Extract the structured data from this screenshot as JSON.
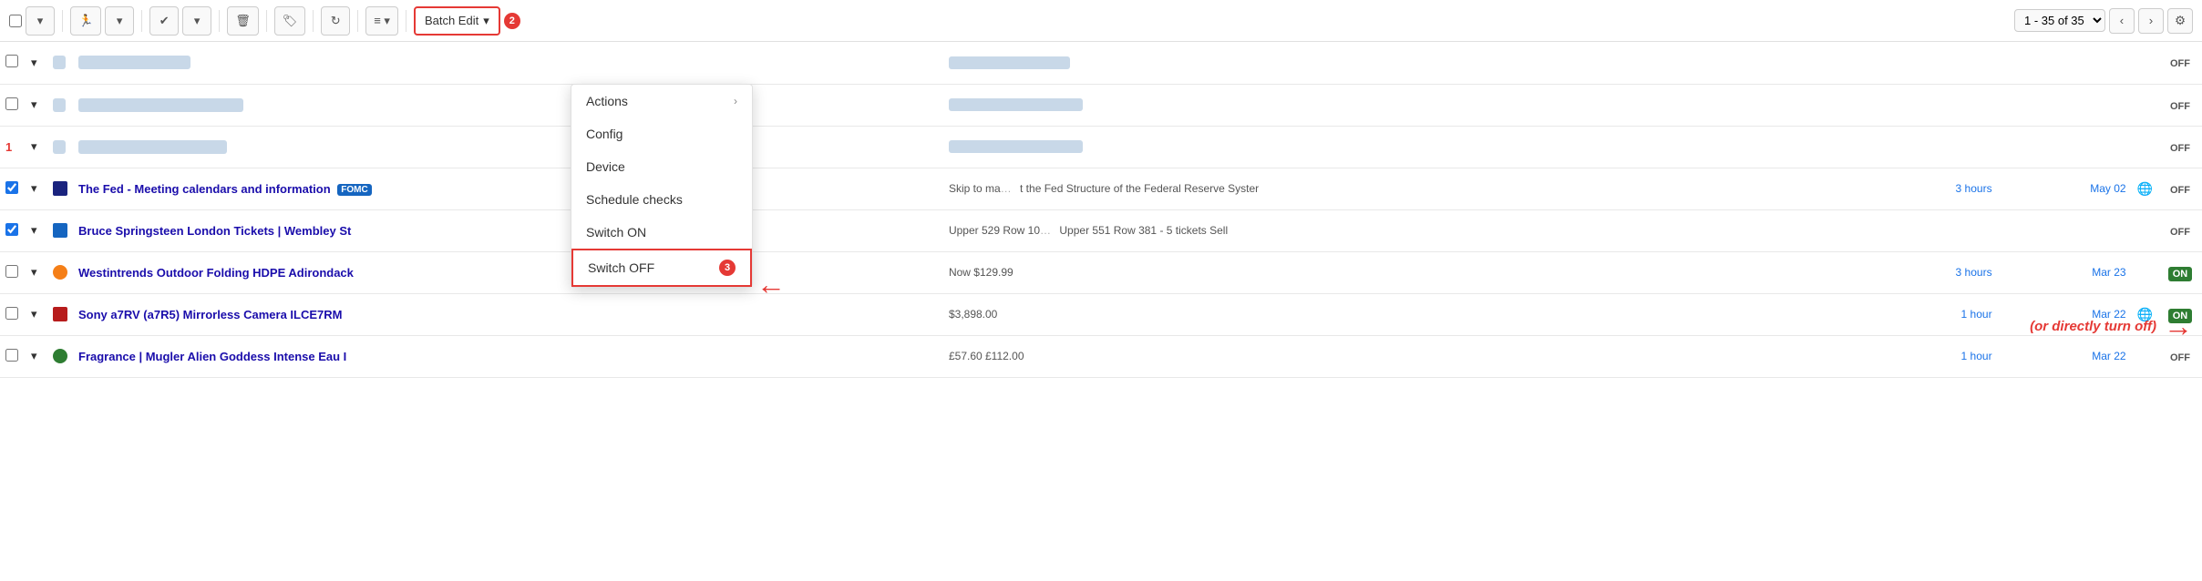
{
  "toolbar": {
    "batch_edit_label": "Batch Edit",
    "badge": "2",
    "pagination": "1 - 35 of 35",
    "dropdown_arrow": "▾"
  },
  "dropdown": {
    "items": [
      {
        "id": "actions",
        "label": "Actions",
        "has_arrow": true,
        "highlighted": false
      },
      {
        "id": "config",
        "label": "Config",
        "has_arrow": false,
        "highlighted": false
      },
      {
        "id": "device",
        "label": "Device",
        "has_arrow": false,
        "highlighted": false
      },
      {
        "id": "schedule-checks",
        "label": "Schedule checks",
        "has_arrow": false,
        "highlighted": false
      },
      {
        "id": "switch-on",
        "label": "Switch ON",
        "has_arrow": false,
        "highlighted": false
      },
      {
        "id": "switch-off",
        "label": "Switch OFF",
        "has_arrow": false,
        "highlighted": true
      }
    ]
  },
  "annotation": {
    "badge3": "3",
    "or_text": "(or directly turn off)"
  },
  "rows": [
    {
      "id": "row1",
      "checked": false,
      "num_badge": "",
      "favicon_class": "",
      "title_blurred": true,
      "title": "",
      "desc_blurred": true,
      "desc": "",
      "time": "",
      "date": "",
      "has_globe": false,
      "status": "OFF"
    },
    {
      "id": "row2",
      "checked": false,
      "num_badge": "",
      "favicon_class": "",
      "title_blurred": true,
      "title": "",
      "desc_blurred": true,
      "desc": "",
      "time": "",
      "date": "",
      "has_globe": false,
      "status": "OFF"
    },
    {
      "id": "row3",
      "checked": false,
      "num_badge": "1",
      "favicon_class": "",
      "title_blurred": true,
      "title": "",
      "desc_blurred": true,
      "desc": "",
      "time": "",
      "date": "",
      "has_globe": false,
      "status": "OFF"
    },
    {
      "id": "row4",
      "checked": true,
      "num_badge": "",
      "favicon_class": "favicon-frb",
      "title": "The Fed - Meeting calendars and information",
      "title_blurred": false,
      "badge": "FOMC",
      "desc": "Skip to ma",
      "desc_blurred": false,
      "desc_extra": "t the Fed Structure of the Federal Reserve Syster",
      "time": "3 hours",
      "date": "May 02",
      "has_globe": true,
      "status": "OFF"
    },
    {
      "id": "row5",
      "checked": true,
      "num_badge": "",
      "favicon_class": "favicon-bru",
      "title": "Bruce Springsteen London Tickets | Wembley St",
      "title_blurred": false,
      "desc": "Upper 529 Row 10",
      "desc_blurred": false,
      "desc_extra": "Upper 551 Row 381 - 5 tickets Sell",
      "time": "",
      "date": "",
      "has_globe": false,
      "status": "OFF"
    },
    {
      "id": "row6",
      "checked": false,
      "num_badge": "",
      "favicon_class": "favicon-west",
      "title": "Westintrends Outdoor Folding HDPE Adirondack",
      "title_blurred": false,
      "desc": "Now $129.99",
      "desc_blurred": false,
      "time": "3 hours",
      "date": "Mar 23",
      "has_globe": false,
      "status": "ON"
    },
    {
      "id": "row7",
      "checked": false,
      "num_badge": "",
      "favicon_class": "favicon-sony",
      "title": "Sony a7RV (a7R5) Mirrorless Camera ILCE7RM",
      "title_blurred": false,
      "desc": "$3,898.00",
      "desc_blurred": false,
      "time": "1 hour",
      "date": "Mar 22",
      "has_globe": true,
      "status": "ON"
    },
    {
      "id": "row8",
      "checked": false,
      "num_badge": "",
      "favicon_class": "favicon-frag",
      "title": "Fragrance | Mugler Alien Goddess Intense Eau I",
      "title_blurred": false,
      "desc": "£57.60 £112.00",
      "desc_blurred": false,
      "time": "1 hour",
      "date": "Mar 22",
      "has_globe": false,
      "status": "OFF"
    }
  ]
}
